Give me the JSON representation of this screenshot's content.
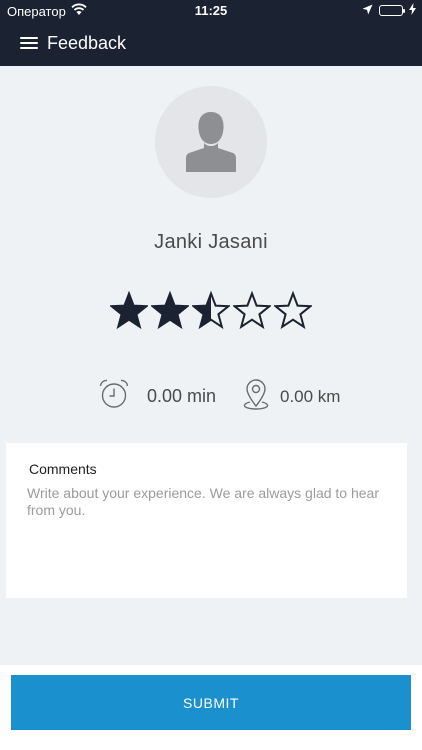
{
  "status_bar": {
    "carrier": "Оператор",
    "time": "11:25",
    "icons": [
      "wifi-icon",
      "location-arrow-icon",
      "battery-icon",
      "charging-bolt-icon"
    ]
  },
  "header": {
    "title": "Feedback",
    "menu_icon": "hamburger-menu-icon",
    "background": "#1b2231"
  },
  "profile": {
    "name": "Janki Jasani",
    "avatar_icon": "person-silhouette-icon"
  },
  "rating": {
    "value": 2.5,
    "max": 5,
    "star_color": "#1b2231"
  },
  "stats": {
    "time_icon": "alarm-clock-icon",
    "time": "0.00 min",
    "distance_icon": "location-pin-icon",
    "distance": "0.00 km"
  },
  "comments": {
    "label": "Comments",
    "value": "",
    "placeholder": "Write about your experience. We are always glad to hear from you."
  },
  "submit": {
    "label": "SUBMIT",
    "color": "#1a90cf"
  }
}
